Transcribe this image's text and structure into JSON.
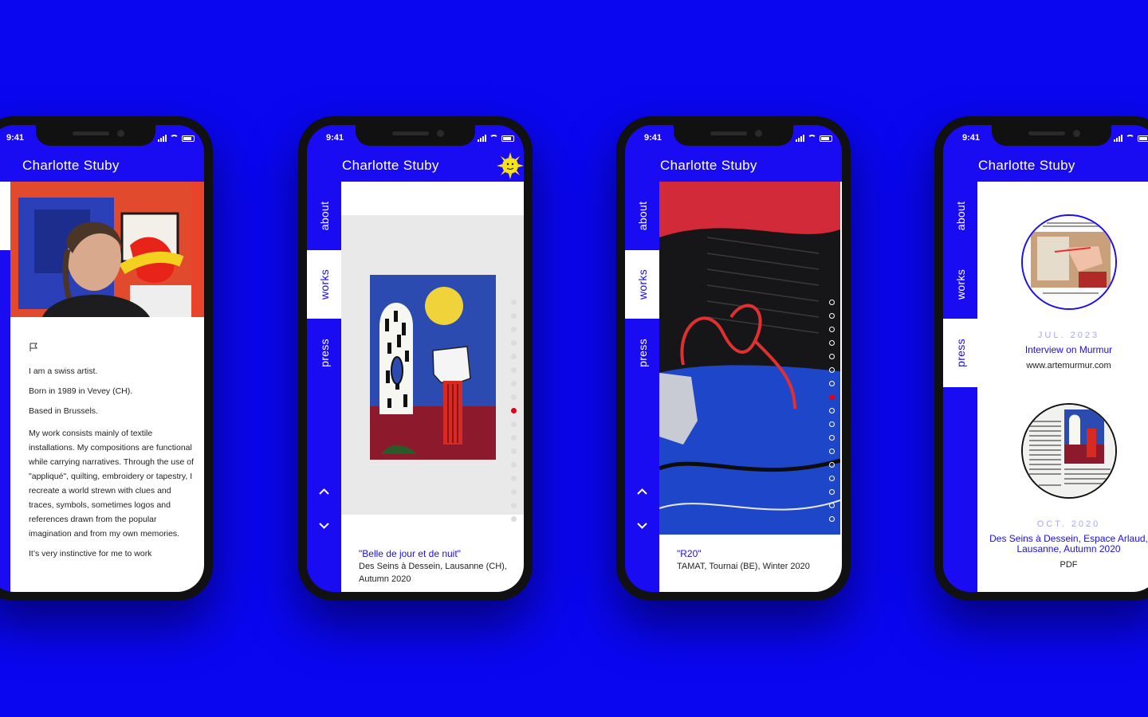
{
  "app": {
    "title": "Charlotte Stuby"
  },
  "status": {
    "time": "9:41"
  },
  "nav": {
    "about": "about",
    "works": "works",
    "press": "press"
  },
  "phone1": {
    "flag_icon": "flag-icon",
    "bio": {
      "line1": "I am a swiss artist.",
      "line2": "Born in 1989 in Vevey (CH).",
      "line3": "Based in Brussels.",
      "paragraph": "My work consists mainly of textile installations. My compositions are functional while carrying narratives. Through the use of \"appliqué\", quilting, embroidery or tapestry, I recreate a world strewn with clues and traces, symbols, sometimes logos and references drawn from the popular imagination and from my own memories.",
      "partial": "It’s very instinctive for me to work"
    }
  },
  "phone2": {
    "work_title": "\"Belle de jour et de nuit\"",
    "work_details": "Des Seins à Dessein, Lausanne (CH), Autumn 2020",
    "dots_total": 17,
    "dots_active": 8
  },
  "phone3": {
    "work_title": "\"R20\"",
    "work_details": "TAMAT, Tournai (BE), Winter 2020",
    "dots_total": 17,
    "dots_active": 7
  },
  "phone4": {
    "items": [
      {
        "date": "JUL. 2023",
        "title": "Interview on Murmur",
        "sub": "www.artemurmur.com"
      },
      {
        "date": "OCT. 2020",
        "title": "Des Seins à Dessein, Espace Arlaud, Lausanne, Autumn 2020",
        "sub": "PDF"
      }
    ]
  },
  "colors": {
    "background": "#0a06f0",
    "accent": "#1a0cf2",
    "active_dot": "#e0001a"
  }
}
